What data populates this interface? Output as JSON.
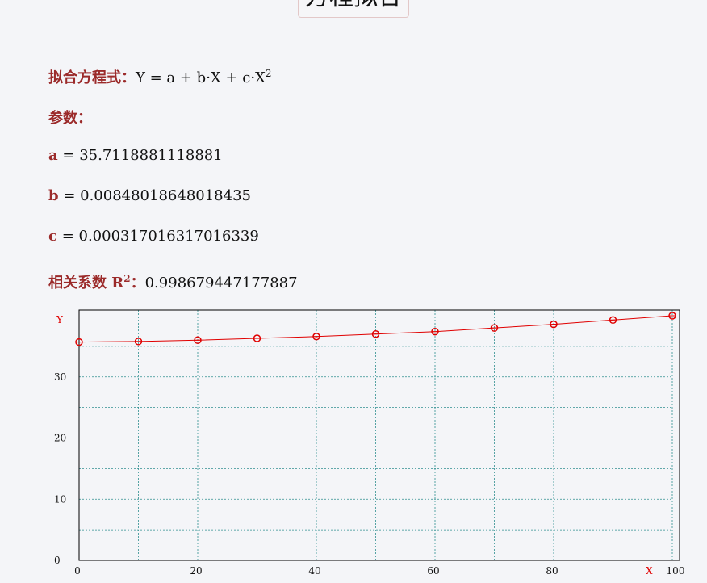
{
  "header": {
    "title": "方程拟合"
  },
  "equation": {
    "label": "拟合方程式：",
    "formula_main": "Y = a + b·X + c·X",
    "formula_sup": "2"
  },
  "params": {
    "label": "参数：",
    "a": {
      "name": "a",
      "eq": " = ",
      "value": "35.7118881118881"
    },
    "b": {
      "name": "b",
      "eq": " = ",
      "value": "0.00848018648018435"
    },
    "c": {
      "name": "c",
      "eq": " = ",
      "value": "0.000317016317016339"
    }
  },
  "correlation": {
    "label": "相关系数 ",
    "symbol": "R",
    "sup": "2",
    "sep": "：",
    "value": "0.998679447177887"
  },
  "colors": {
    "accent": "#9b2a2a",
    "series": "#e00000",
    "grid": "#2f8f8f",
    "axis": "#000000"
  },
  "chart_data": {
    "type": "line",
    "xlabel": "X",
    "ylabel": "Y",
    "xlim": [
      0,
      100
    ],
    "ylim": [
      0,
      40
    ],
    "x_ticks": [
      0,
      20,
      40,
      60,
      80,
      100
    ],
    "y_ticks": [
      0,
      10,
      20,
      30
    ],
    "grid": true,
    "series": [
      {
        "x": [
          0,
          10,
          20,
          30,
          40,
          50,
          60,
          70,
          80,
          90,
          100
        ],
        "y": [
          35.7,
          35.8,
          36.0,
          36.3,
          36.6,
          37.0,
          37.4,
          38.0,
          38.6,
          39.3,
          40.0
        ]
      }
    ]
  }
}
